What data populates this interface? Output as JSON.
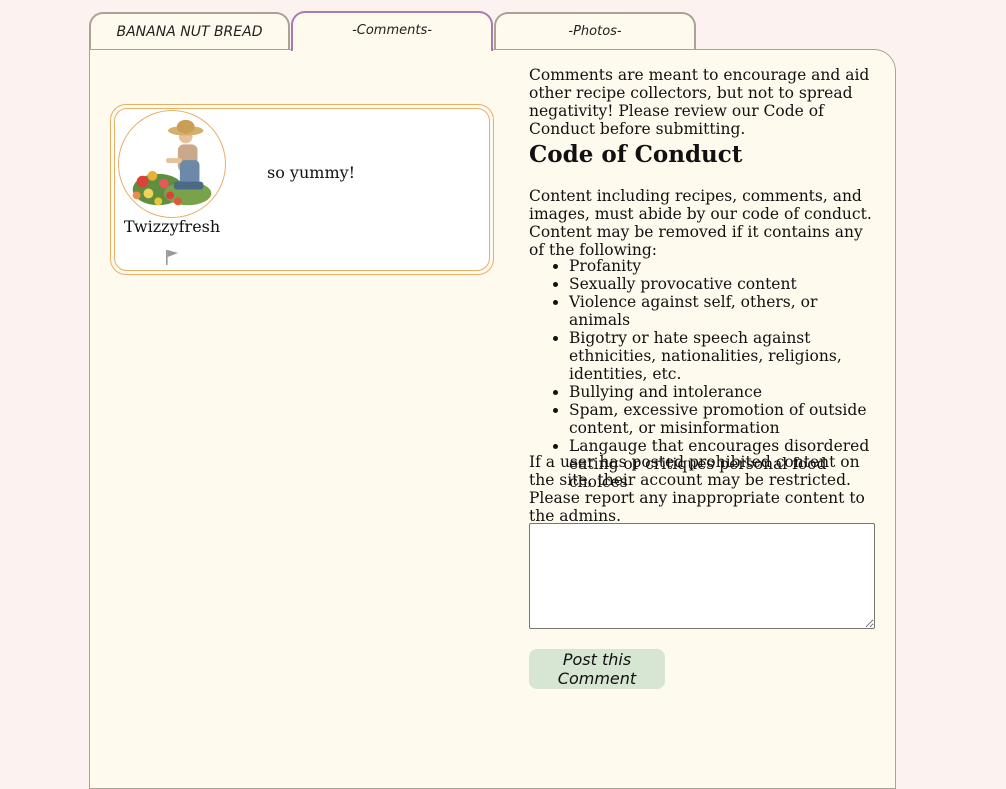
{
  "tabs": {
    "recipe": "BANANA NUT BREAD",
    "comments": "-Comments-",
    "photos": "-Photos-"
  },
  "comment": {
    "username": "Twizzyfresh",
    "text": "so yummy!",
    "avatar_icon": "gardener-avatar",
    "flag_icon": "flag-icon"
  },
  "guidelines": {
    "intro": "Comments are meant to encourage and aid other recipe collectors, but not to spread negativity! Please review our Code of Conduct before submitting.",
    "heading": "Code of Conduct",
    "body": "Content including recipes, comments, and images, must abide by our code of conduct. Content may be removed if it contains any of the following:",
    "rules": [
      "Profanity",
      "Sexually provocative content",
      "Violence against self, others, or animals",
      "Bigotry or hate speech against ethnicities, nationalities, religions, identities, etc.",
      "Bullying and intolerance",
      "Spam, excessive promotion of outside content, or misinformation",
      "Langauge that encourages disordered eating or critiques personal food choices"
    ],
    "report": "If a user has posted prohibited content on the site, their account may be restricted. Please report any inappropriate content to the admins."
  },
  "form": {
    "comment_value": "",
    "post_label": "Post this Comment"
  },
  "colors": {
    "page_bg": "#fcf2ef",
    "panel_bg": "#fffaee",
    "card_border": "#e6b06a",
    "active_tab_border": "#a87ab0",
    "button_bg": "#d6e6d2"
  }
}
